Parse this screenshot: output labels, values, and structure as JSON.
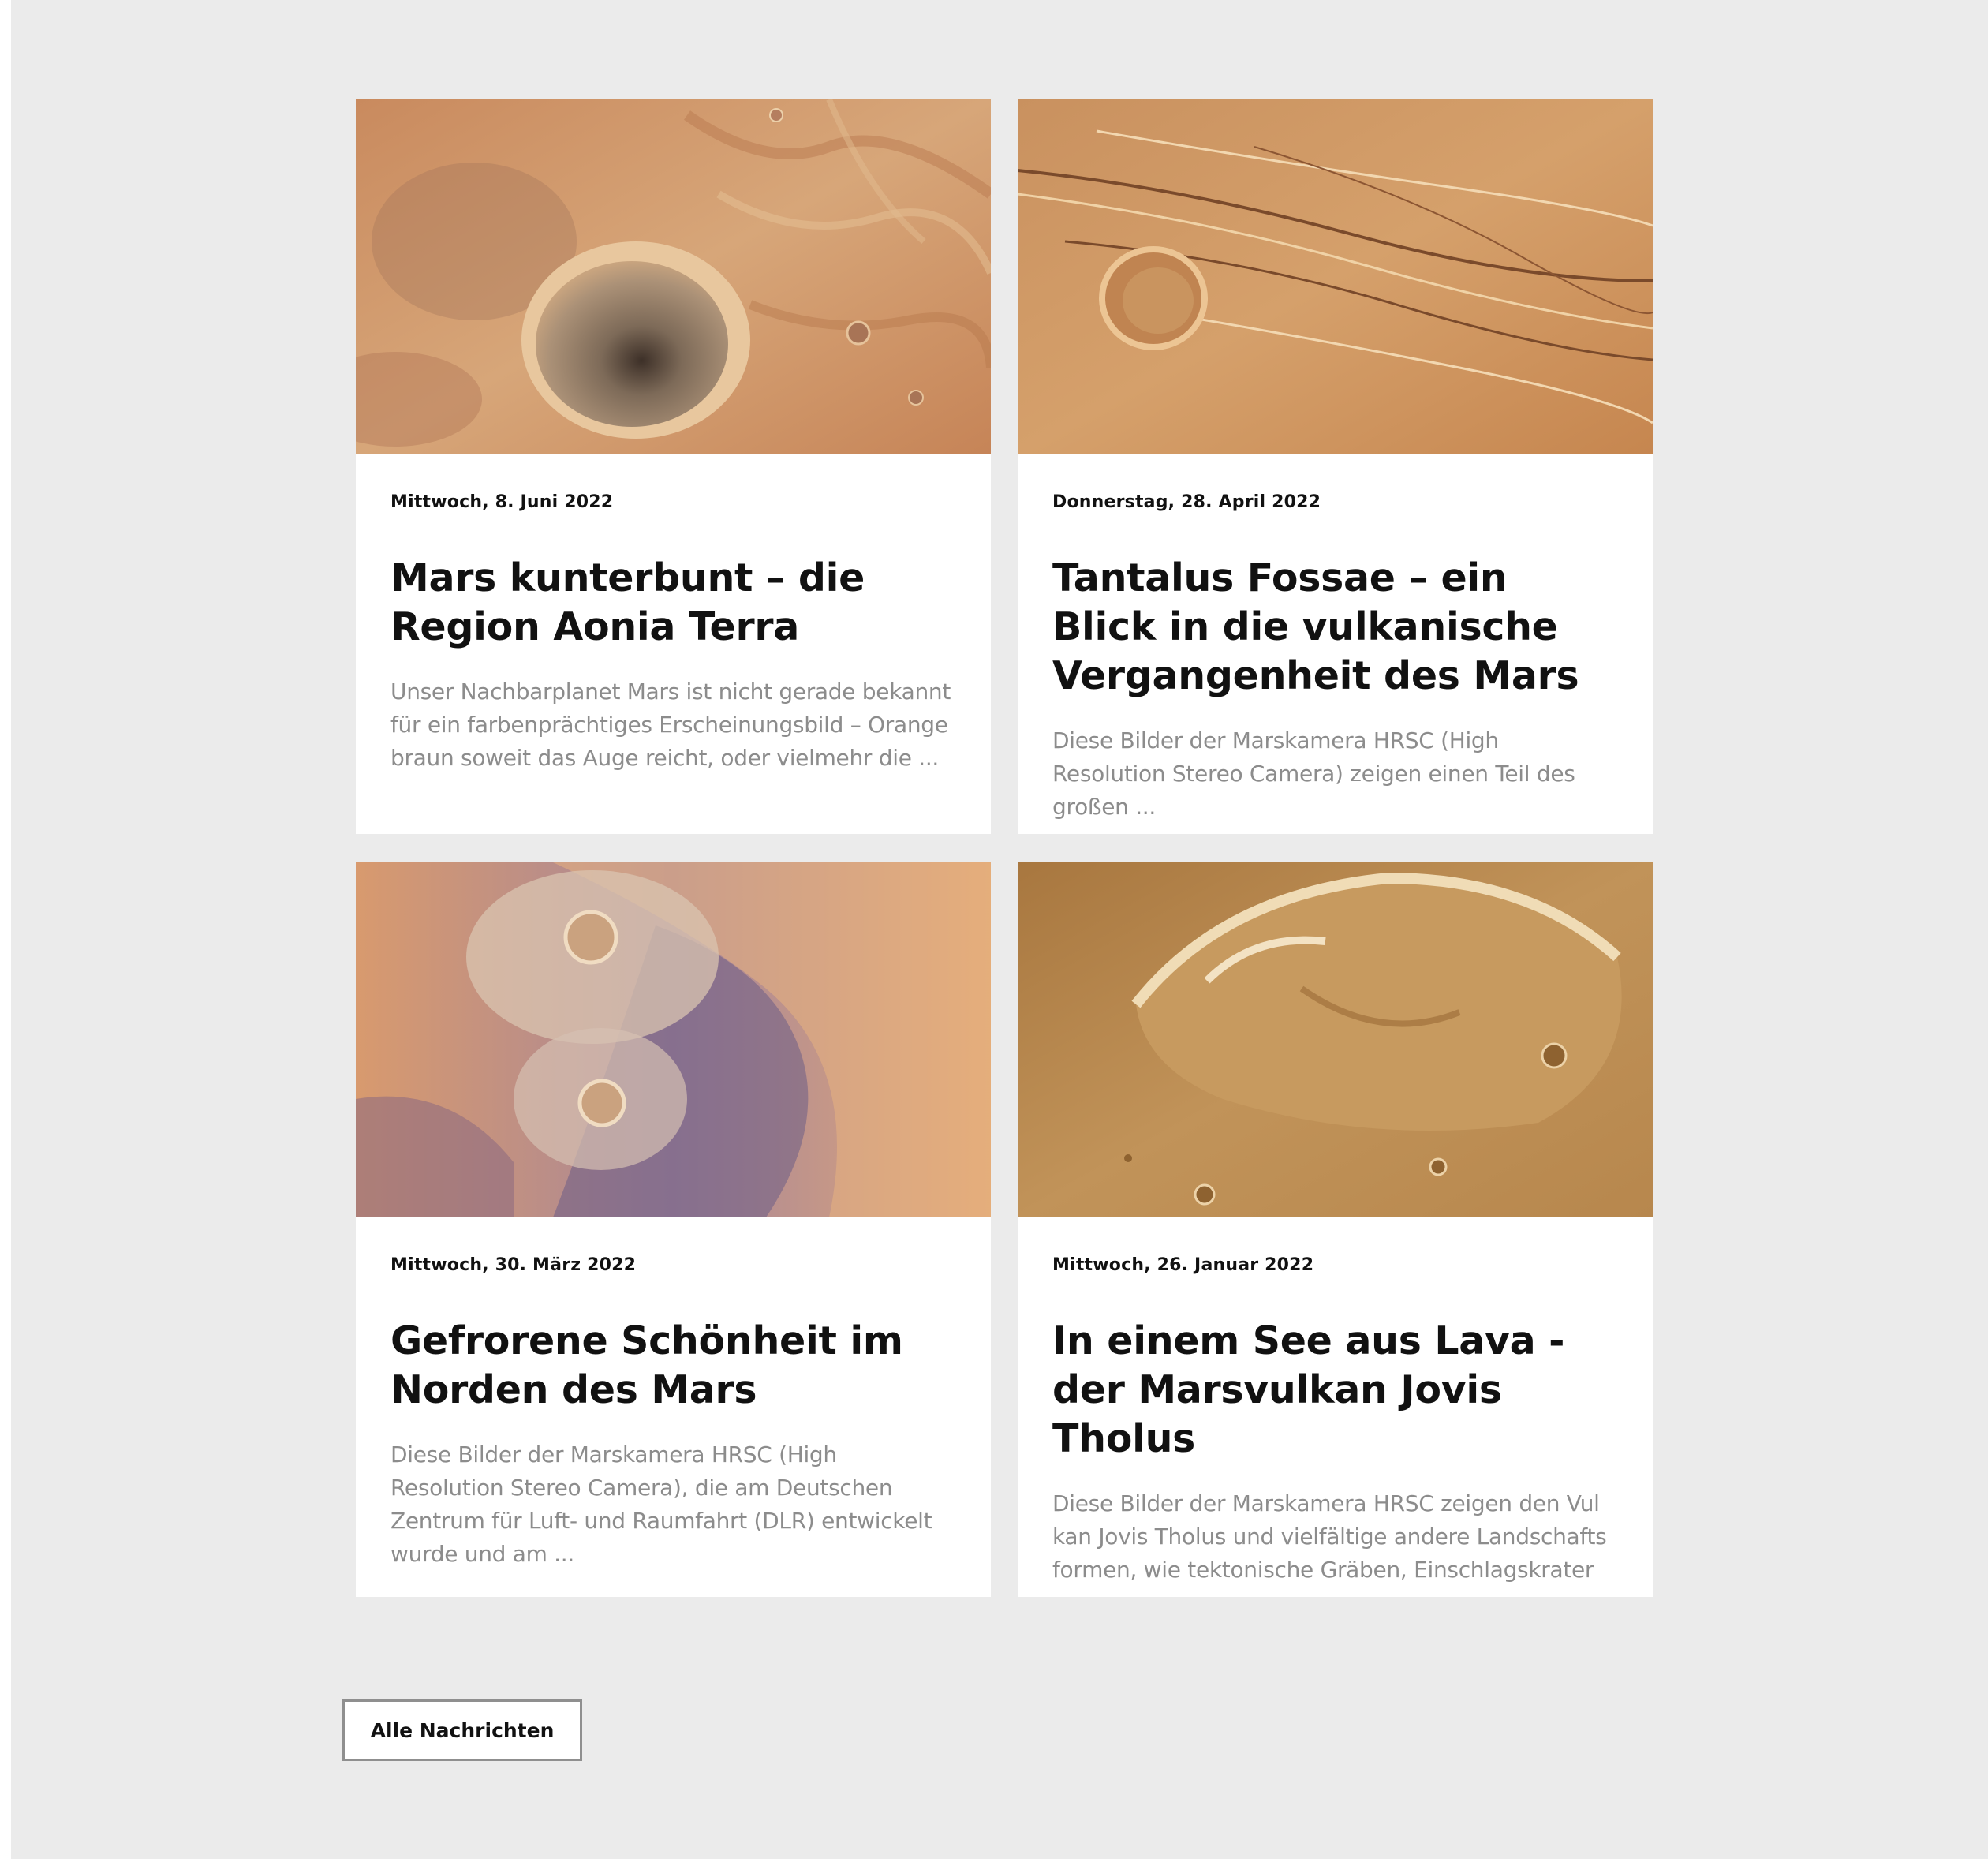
{
  "news": {
    "items": [
      {
        "date": "Mittwoch, 8. Juni 2022",
        "title": "Mars kunterbunt – die Region Aonia Terra",
        "teaser": "Unser Nachbarplanet Mars ist nicht gerade bekannt für ein farbenprächtiges Erscheinungsbild – Orange braun soweit das Auge reicht, oder vielmehr die ..."
      },
      {
        "date": "Donnerstag, 28. April 2022",
        "title": "Tantalus Fossae – ein Blick in die vulkanische Ver­gangenheit des Mars",
        "teaser": "Diese Bilder der Marskamera HRSC (High Resolution Stereo Camera) zeigen einen Teil des großen ..."
      },
      {
        "date": "Mittwoch, 30. März 2022",
        "title": "Gefrorene Schönheit im Norden des Mars",
        "teaser": "Diese Bilder der Marskamera HRSC (High Resolution Stereo Camera), die am Deutschen Zentrum für Luft- und Raumfahrt (DLR) entwickelt wurde und am ..."
      },
      {
        "date": "Mittwoch, 26. Januar 2022",
        "title": "In einem See aus Lava - der Marsvulkan Jovis Tholus",
        "teaser": "Diese Bilder der Marskamera HRSC zeigen den Vul kan Jovis Tholus und vielfältige andere Landschafts formen, wie tektonische Gräben, Einschlagskrater ..."
      }
    ],
    "all_news_label": "Alle Nachrichten"
  }
}
